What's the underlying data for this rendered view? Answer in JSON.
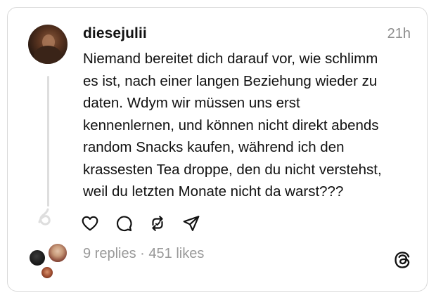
{
  "post": {
    "username": "diesejulii",
    "timestamp": "21h",
    "text_lines": [
      "Niemand bereitet dich darauf vor, wie schlimm",
      "es ist, nach einer langen Beziehung wieder zu",
      "daten. Wdym wir müssen uns erst",
      "kennenlernen, und können nicht direkt abends",
      "random Snacks kaufen, während ich den",
      "krassesten Tea droppe, den du nicht verstehst,",
      "weil du letzten Monate nicht da warst???"
    ],
    "replies": "9 replies",
    "separator": " · ",
    "likes": "451 likes"
  },
  "icons": {
    "like": "heart-icon",
    "reply": "comment-icon",
    "repost": "repost-icon",
    "share": "send-icon",
    "app": "threads-logo-icon"
  },
  "colors": {
    "text": "#111111",
    "muted": "#999999",
    "border": "#d9d9d9",
    "thread_line": "#dedede"
  }
}
